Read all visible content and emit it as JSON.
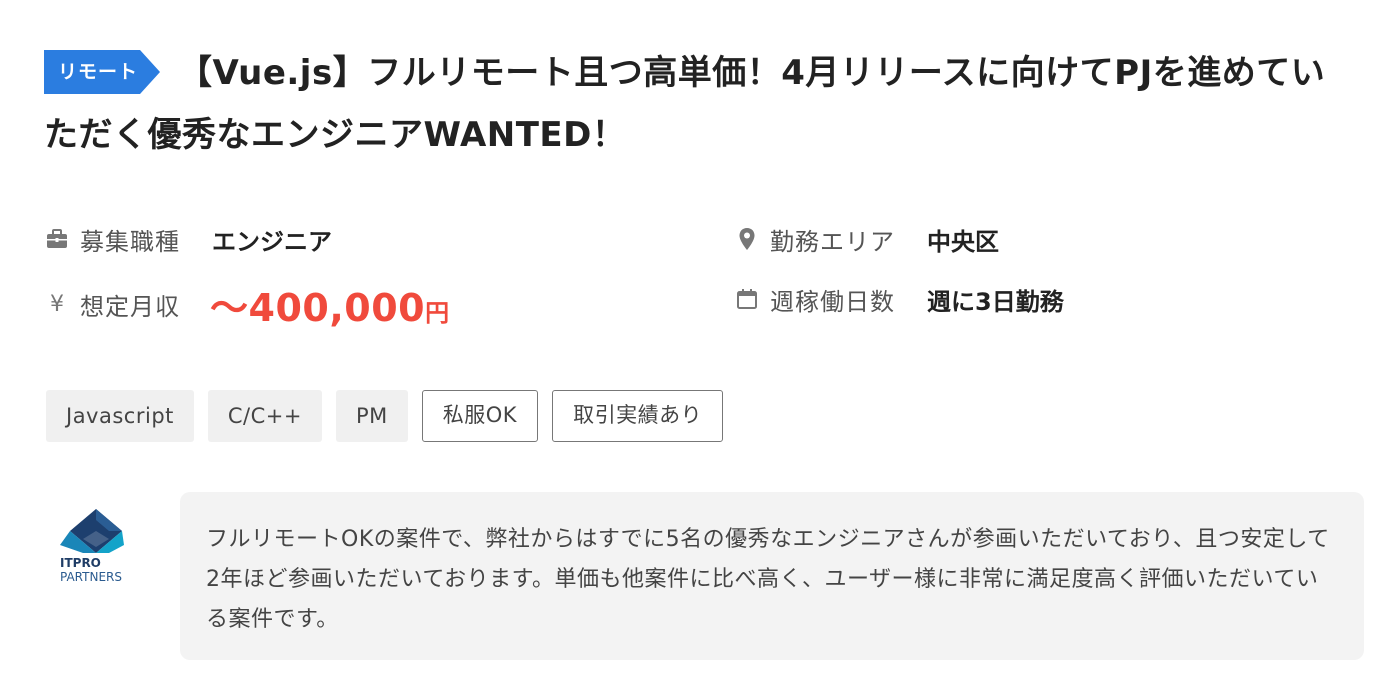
{
  "job": {
    "badge": "リモート",
    "title": "【Vue.js】フルリモート且つ高単価！4月リリースに向けてPJを進めていただく優秀なエンジニアWANTED！"
  },
  "info": {
    "position": {
      "label": "募集職種",
      "value": "エンジニア",
      "icon": "briefcase-icon"
    },
    "salary": {
      "label": "想定月収",
      "value": "〜400,000",
      "unit": "円",
      "icon": "yen-icon"
    },
    "area": {
      "label": "勤務エリア",
      "value": "中央区",
      "icon": "map-pin-icon"
    },
    "workdays": {
      "label": "週稼働日数",
      "value": "週に3日勤務",
      "icon": "calendar-icon"
    }
  },
  "tags": [
    {
      "label": "Javascript",
      "style": "filled"
    },
    {
      "label": "C/C++",
      "style": "filled"
    },
    {
      "label": "PM",
      "style": "filled"
    },
    {
      "label": "私服OK",
      "style": "outline"
    },
    {
      "label": "取引実績あり",
      "style": "outline"
    }
  ],
  "company": {
    "logo_line1": "ITPRO",
    "logo_line2": "PARTNERS",
    "comment": "フルリモートOKの案件で、弊社からはすでに5名の優秀なエンジニアさんが参画いただいており、且つ安定して2年ほど参画いただいております。単価も他案件に比べ高く、ユーザー様に非常に満足度高く評価いただいている案件です。"
  },
  "colors": {
    "badge": "#2b7de0",
    "salary": "#f04a3c",
    "comment_bg": "#f3f3f3"
  }
}
